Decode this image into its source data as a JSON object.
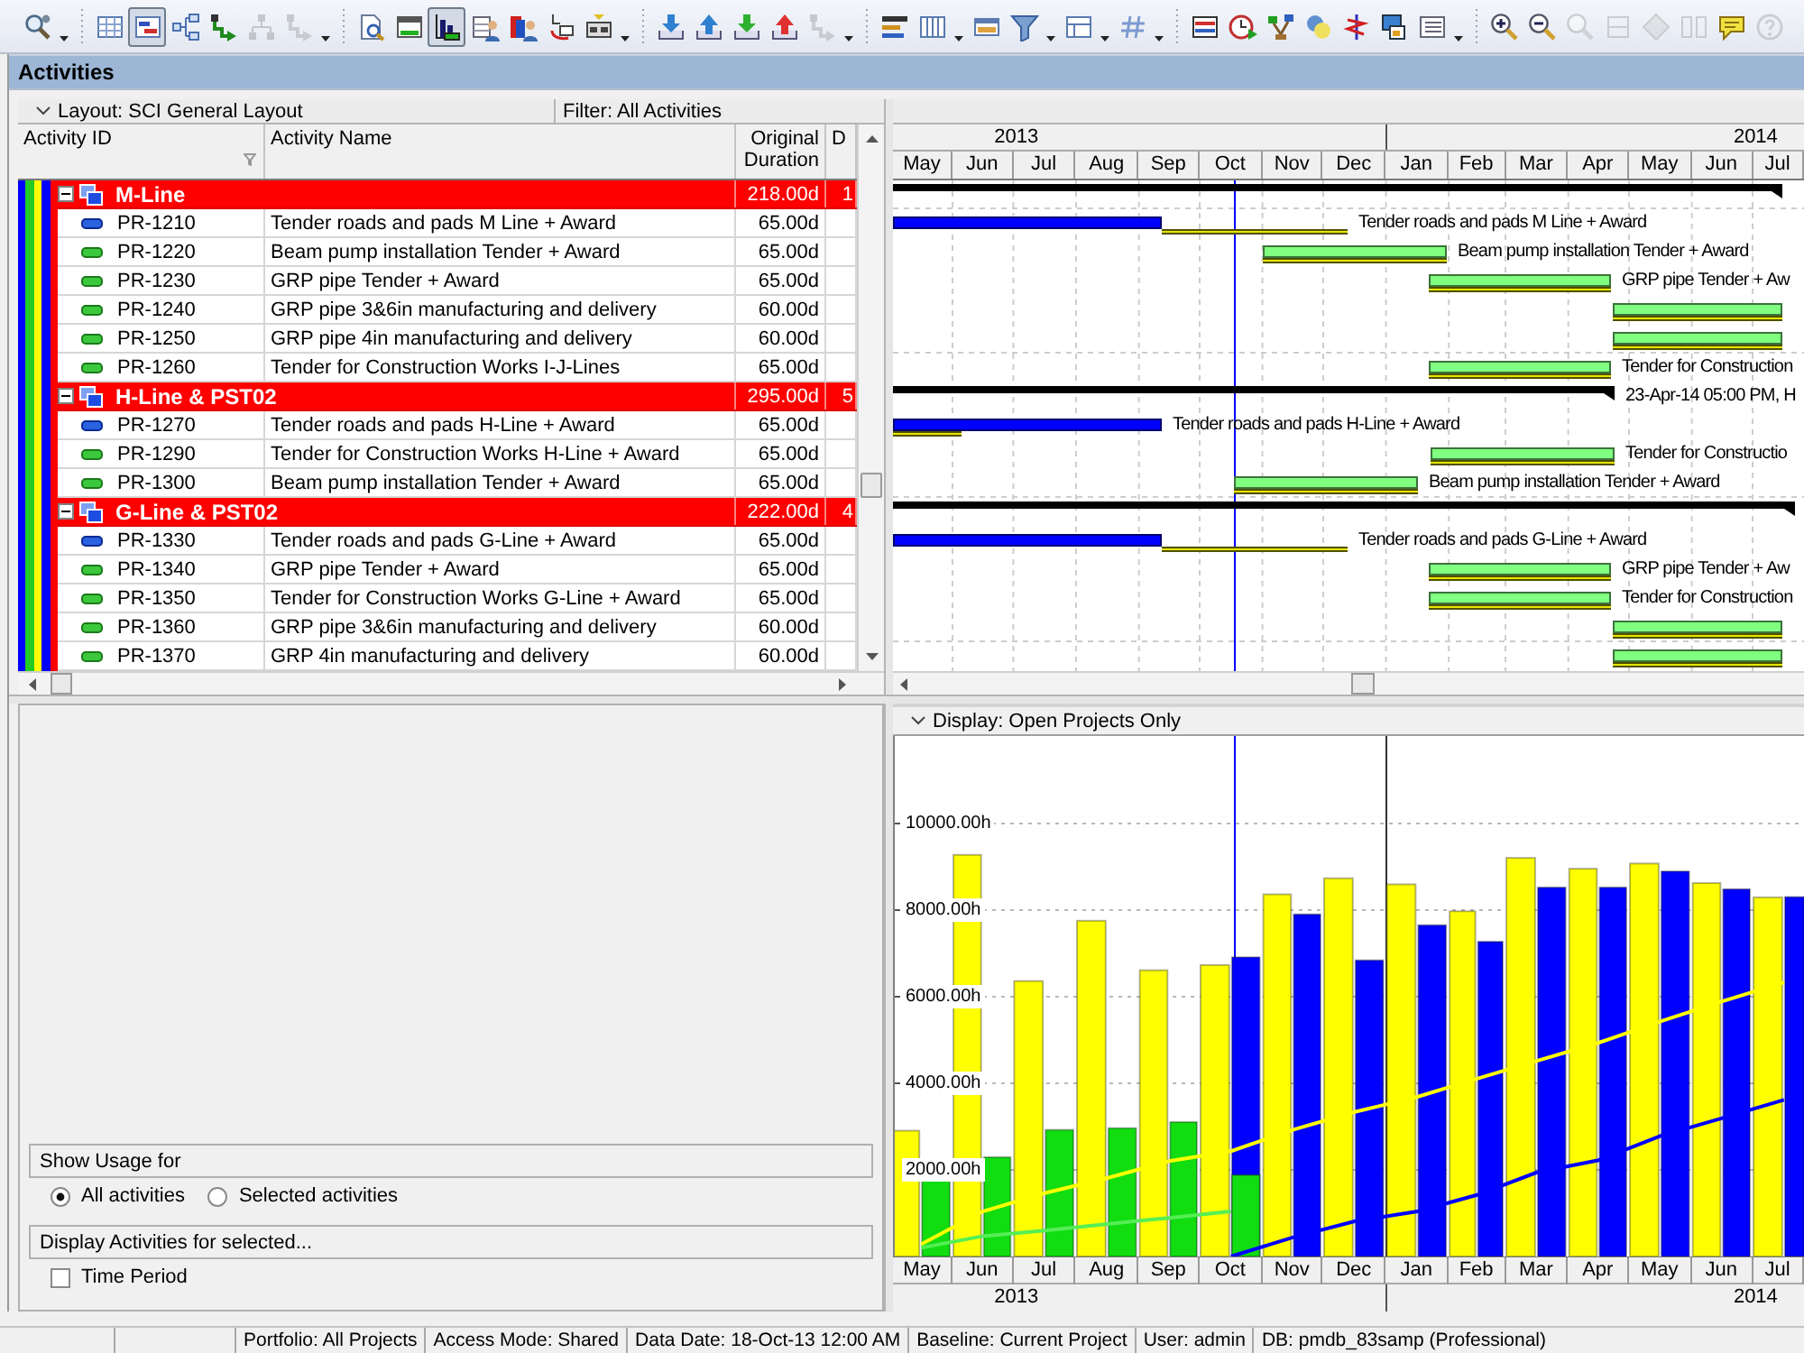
{
  "toolbar": [
    {
      "selected": false,
      "disabled": false
    },
    {
      "selected": false,
      "disabled": false
    },
    {
      "selected": true,
      "disabled": false
    },
    {
      "selected": false,
      "disabled": false
    },
    {
      "selected": false,
      "disabled": false
    },
    {
      "selected": false,
      "disabled": true
    },
    {
      "selected": false,
      "disabled": true
    },
    {
      "selected": false,
      "disabled": false
    },
    {
      "selected": false,
      "disabled": false
    },
    {
      "selected": true,
      "disabled": false
    },
    {
      "selected": false,
      "disabled": false
    },
    {
      "selected": false,
      "disabled": false
    },
    {
      "selected": false,
      "disabled": false
    },
    {
      "selected": false,
      "disabled": false
    },
    {
      "selected": false,
      "disabled": false
    },
    {
      "selected": false,
      "disabled": false
    },
    {
      "selected": false,
      "disabled": false
    },
    {
      "selected": false,
      "disabled": false
    },
    {
      "selected": false,
      "disabled": true
    },
    {
      "selected": false,
      "disabled": false
    },
    {
      "selected": false,
      "disabled": false
    },
    {
      "selected": false,
      "disabled": false
    },
    {
      "selected": false,
      "disabled": false
    },
    {
      "selected": false,
      "disabled": false
    },
    {
      "selected": false,
      "disabled": false
    },
    {
      "selected": false,
      "disabled": false
    },
    {
      "selected": false,
      "disabled": false
    },
    {
      "selected": false,
      "disabled": false
    },
    {
      "selected": false,
      "disabled": false
    },
    {
      "selected": false,
      "disabled": false
    },
    {
      "selected": false,
      "disabled": false
    },
    {
      "selected": false,
      "disabled": false
    },
    {
      "selected": false,
      "disabled": false
    },
    {
      "selected": false,
      "disabled": false
    },
    {
      "selected": false,
      "disabled": true
    },
    {
      "selected": false,
      "disabled": true
    },
    {
      "selected": false,
      "disabled": true
    },
    {
      "selected": false,
      "disabled": true
    },
    {
      "selected": false,
      "disabled": false
    },
    {
      "selected": false,
      "disabled": true
    }
  ],
  "panel": {
    "title": "Activities"
  },
  "layout_bar": {
    "layout": "Layout: SCI General Layout",
    "filter": "Filter: All Activities"
  },
  "table": {
    "columns": [
      "Activity ID",
      "Activity Name",
      "Original Duration",
      "D"
    ],
    "groups": [
      {
        "name": "M-Line",
        "expanded": true,
        "original_duration": "218.00d",
        "column_4": "1",
        "activities": [
          {
            "id": "PR-1210",
            "name": "Tender roads and pads M Line + Award",
            "original_duration": "65.00d",
            "started": true
          },
          {
            "id": "PR-1220",
            "name": "Beam pump installation Tender + Award",
            "original_duration": "65.00d",
            "started": false
          },
          {
            "id": "PR-1230",
            "name": "GRP pipe Tender + Award",
            "original_duration": "65.00d",
            "started": false
          },
          {
            "id": "PR-1240",
            "name": "GRP pipe 3&6in manufacturing and delivery",
            "original_duration": "60.00d",
            "started": false
          },
          {
            "id": "PR-1250",
            "name": "GRP pipe 4in manufacturing and delivery",
            "original_duration": "60.00d",
            "started": false
          },
          {
            "id": "PR-1260",
            "name": "Tender for Construction Works I-J-Lines",
            "original_duration": "65.00d",
            "started": false
          }
        ]
      },
      {
        "name": "H-Line & PST02",
        "expanded": true,
        "original_duration": "295.00d",
        "column_4": "5",
        "activities": [
          {
            "id": "PR-1270",
            "name": "Tender roads and pads H-Line + Award",
            "original_duration": "65.00d",
            "started": true
          },
          {
            "id": "PR-1290",
            "name": "Tender for Construction Works H-Line + Award",
            "original_duration": "65.00d",
            "started": false
          },
          {
            "id": "PR-1300",
            "name": "Beam pump installation Tender + Award",
            "original_duration": "65.00d",
            "started": false
          }
        ]
      },
      {
        "name": "G-Line & PST02",
        "expanded": true,
        "original_duration": "222.00d",
        "column_4": "4",
        "activities": [
          {
            "id": "PR-1330",
            "name": "Tender roads and pads G-Line + Award",
            "original_duration": "65.00d",
            "started": true
          },
          {
            "id": "PR-1340",
            "name": "GRP pipe Tender + Award",
            "original_duration": "65.00d",
            "started": false
          },
          {
            "id": "PR-1350",
            "name": "Tender for Construction Works G-Line + Award",
            "original_duration": "65.00d",
            "started": false
          },
          {
            "id": "PR-1360",
            "name": "GRP pipe 3&6in manufacturing and delivery",
            "original_duration": "60.00d",
            "started": false
          },
          {
            "id": "PR-1370",
            "name": "GRP 4in manufacturing and delivery",
            "original_duration": "60.00d",
            "started": false
          }
        ]
      }
    ]
  },
  "gantt": {
    "years": [
      "2013",
      "2014"
    ],
    "months": [
      "May",
      "Jun",
      "Jul",
      "Aug",
      "Sep",
      "Oct",
      "Nov",
      "Dec",
      "Jan",
      "Feb",
      "Mar",
      "Apr",
      "May",
      "Jun",
      "Jul"
    ],
    "rows": [
      {
        "kind": "summary"
      },
      {
        "kind": "activity",
        "started": true,
        "label": "Tender roads and pads M Line + Award"
      },
      {
        "kind": "activity",
        "started": false,
        "label": "Beam pump installation Tender + Award"
      },
      {
        "kind": "activity",
        "started": false,
        "label": "GRP pipe Tender + Aw"
      },
      {
        "kind": "activity",
        "started": false
      },
      {
        "kind": "activity",
        "started": false
      },
      {
        "kind": "activity",
        "started": false,
        "label": "Tender for Construction"
      },
      {
        "kind": "summary",
        "label": "23-Apr-14 05:00 PM, H"
      },
      {
        "kind": "activity",
        "started": true,
        "label": "Tender roads and pads H-Line + Award"
      },
      {
        "kind": "activity",
        "started": false,
        "label": "Tender for Constructio"
      },
      {
        "kind": "activity",
        "started": false,
        "label": "Beam pump installation Tender + Award"
      },
      {
        "kind": "summary"
      },
      {
        "kind": "activity",
        "started": true,
        "label": "Tender roads and pads G-Line + Award"
      },
      {
        "kind": "activity",
        "started": false,
        "label": "GRP pipe Tender + Aw"
      },
      {
        "kind": "activity",
        "started": false,
        "label": "Tender for Construction"
      },
      {
        "kind": "activity",
        "started": false
      },
      {
        "kind": "activity",
        "started": false
      }
    ]
  },
  "usage_options": {
    "groups": [
      {
        "title": "Show Usage for",
        "options": [
          {
            "kind": "radio",
            "label": "All activities",
            "selected": true
          },
          {
            "kind": "radio",
            "label": "Selected activities",
            "selected": false
          }
        ]
      },
      {
        "title": "Display Activities for selected...",
        "options": [
          {
            "kind": "checkbox",
            "label": "Time Period",
            "checked": false
          }
        ]
      }
    ]
  },
  "usage_chart": {
    "header": "Display: Open Projects Only",
    "years": [
      "2013",
      "2014"
    ],
    "chart_data": {
      "type": "bar",
      "grid": true,
      "categories": [
        "May",
        "Jun",
        "Jul",
        "Aug",
        "Sep",
        "Oct",
        "Nov",
        "Dec",
        "Jan",
        "Feb",
        "Mar",
        "Apr",
        "May",
        "Jun",
        "Jul"
      ],
      "ylim": [
        0,
        12000
      ],
      "yticks": [
        {
          "value": 2000,
          "label": "2000.00h"
        },
        {
          "value": 4000,
          "label": "4000.00h"
        },
        {
          "value": 6000,
          "label": "6000.00h"
        },
        {
          "value": 8000,
          "label": "8000.00h"
        },
        {
          "value": 10000,
          "label": "10000.00h"
        }
      ],
      "series": [
        {
          "type": "bar",
          "color": "#ffff00",
          "values": [
            2900,
            9260,
            6350,
            7740,
            6600,
            6720,
            8350,
            8720,
            8580,
            7960,
            9190,
            8940,
            9060,
            8610,
            8280
          ]
        },
        {
          "type": "bar",
          "color": "#0000ff",
          "values": [
            null,
            null,
            null,
            null,
            null,
            6900,
            7890,
            6830,
            7640,
            7260,
            8510,
            8510,
            8880,
            8470,
            8290
          ]
        },
        {
          "type": "bar",
          "color": "#11dd11",
          "values": [
            1800,
            2290,
            2920,
            2960,
            3100,
            1880,
            null,
            null,
            null,
            null,
            null,
            null,
            null,
            null,
            null
          ]
        },
        {
          "type": "line",
          "color": "#ffff00",
          "values": [
            280,
            1040,
            1460,
            1810,
            2200,
            2430,
            2920,
            3330,
            3680,
            4100,
            4510,
            4930,
            5420,
            5880,
            6320
          ]
        },
        {
          "type": "line",
          "color": "#55ee55",
          "values": [
            200,
            470,
            600,
            750,
            890,
            1040,
            null,
            null,
            null,
            null,
            null,
            null,
            null,
            null,
            null
          ]
        },
        {
          "type": "line",
          "color": "#0000ff",
          "values": [
            null,
            null,
            null,
            null,
            null,
            0,
            440,
            810,
            1040,
            1420,
            1940,
            2220,
            2780,
            3190,
            3610
          ]
        }
      ]
    }
  },
  "status_bar": [
    "Portfolio: All Projects",
    "Access Mode: Shared",
    "Data Date: 18-Oct-13 12:00 AM",
    "Baseline: Current Project",
    "User: admin",
    "DB: pmdb_83samp (Professional)"
  ]
}
